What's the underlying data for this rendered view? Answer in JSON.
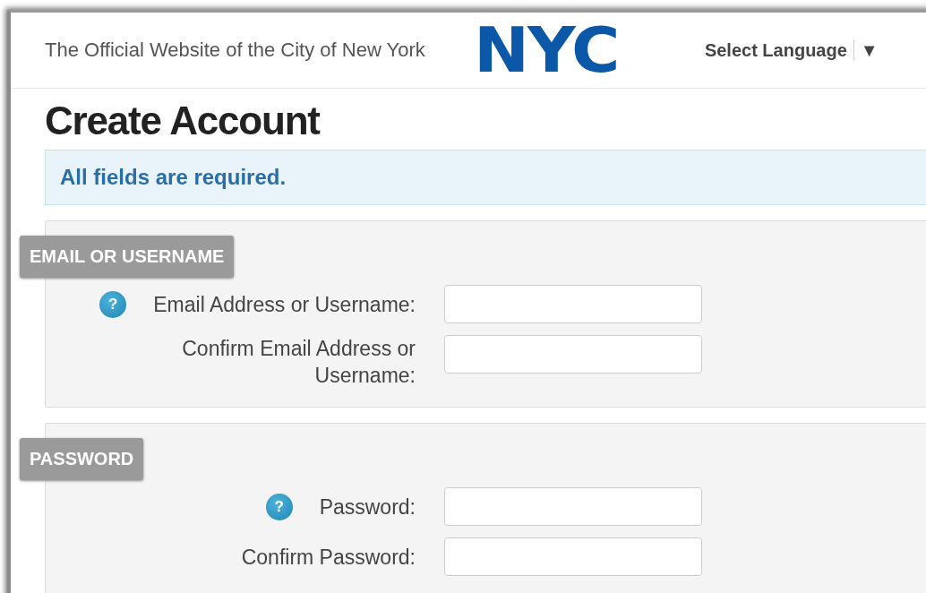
{
  "header": {
    "tagline": "The Official Website of the City of New York",
    "logo": "NYC",
    "language_select": {
      "label": "Select Language",
      "caret": "▼"
    }
  },
  "page_title": "Create Account",
  "notice": "All fields are required.",
  "sections": [
    {
      "heading": "EMAIL OR USERNAME",
      "fields": [
        {
          "label": "Email Address or Username:",
          "help_icon": "?"
        },
        {
          "label": "Confirm Email Address or Username:"
        }
      ]
    },
    {
      "heading": "PASSWORD",
      "fields": [
        {
          "label": "Password:",
          "help_icon": "?"
        },
        {
          "label": "Confirm Password:"
        }
      ]
    }
  ]
}
